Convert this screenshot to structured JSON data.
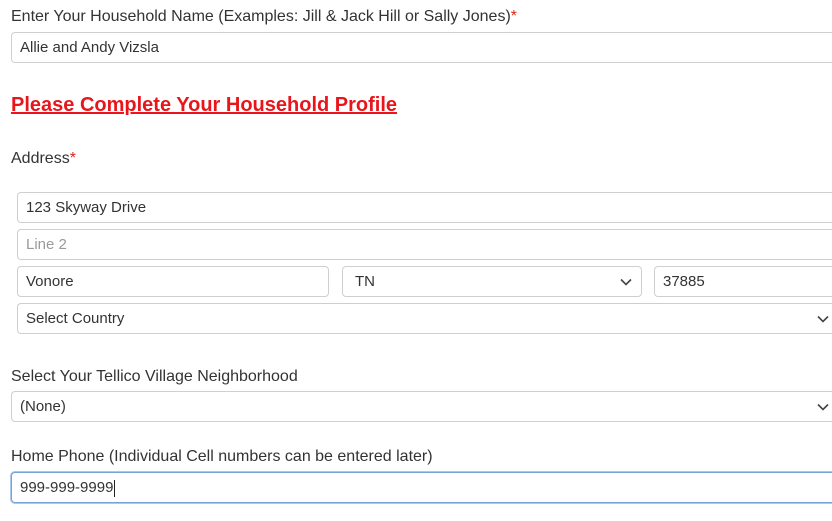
{
  "household": {
    "label": "Enter Your Household Name (Examples: Jill & Jack Hill or Sally Jones)",
    "required_mark": "*",
    "value": "Allie and Andy Vizsla"
  },
  "profile_heading": "Please Complete Your Household Profile",
  "address": {
    "label": "Address",
    "required_mark": "*",
    "line1": "123 Skyway Drive",
    "line2_placeholder": "Line 2",
    "city": "Vonore",
    "state": "TN",
    "zip": "37885",
    "country": "Select Country"
  },
  "neighborhood": {
    "label": "Select Your Tellico Village Neighborhood",
    "value": "(None)"
  },
  "phone": {
    "label": "Home Phone (Individual Cell numbers can be entered later)",
    "value": "999-999-9999"
  },
  "icons": {
    "dropdown": "chevron-down-icon"
  },
  "colors": {
    "required": "#d9261c",
    "heading": "#e8161c",
    "focus_border": "#74a5d6"
  }
}
